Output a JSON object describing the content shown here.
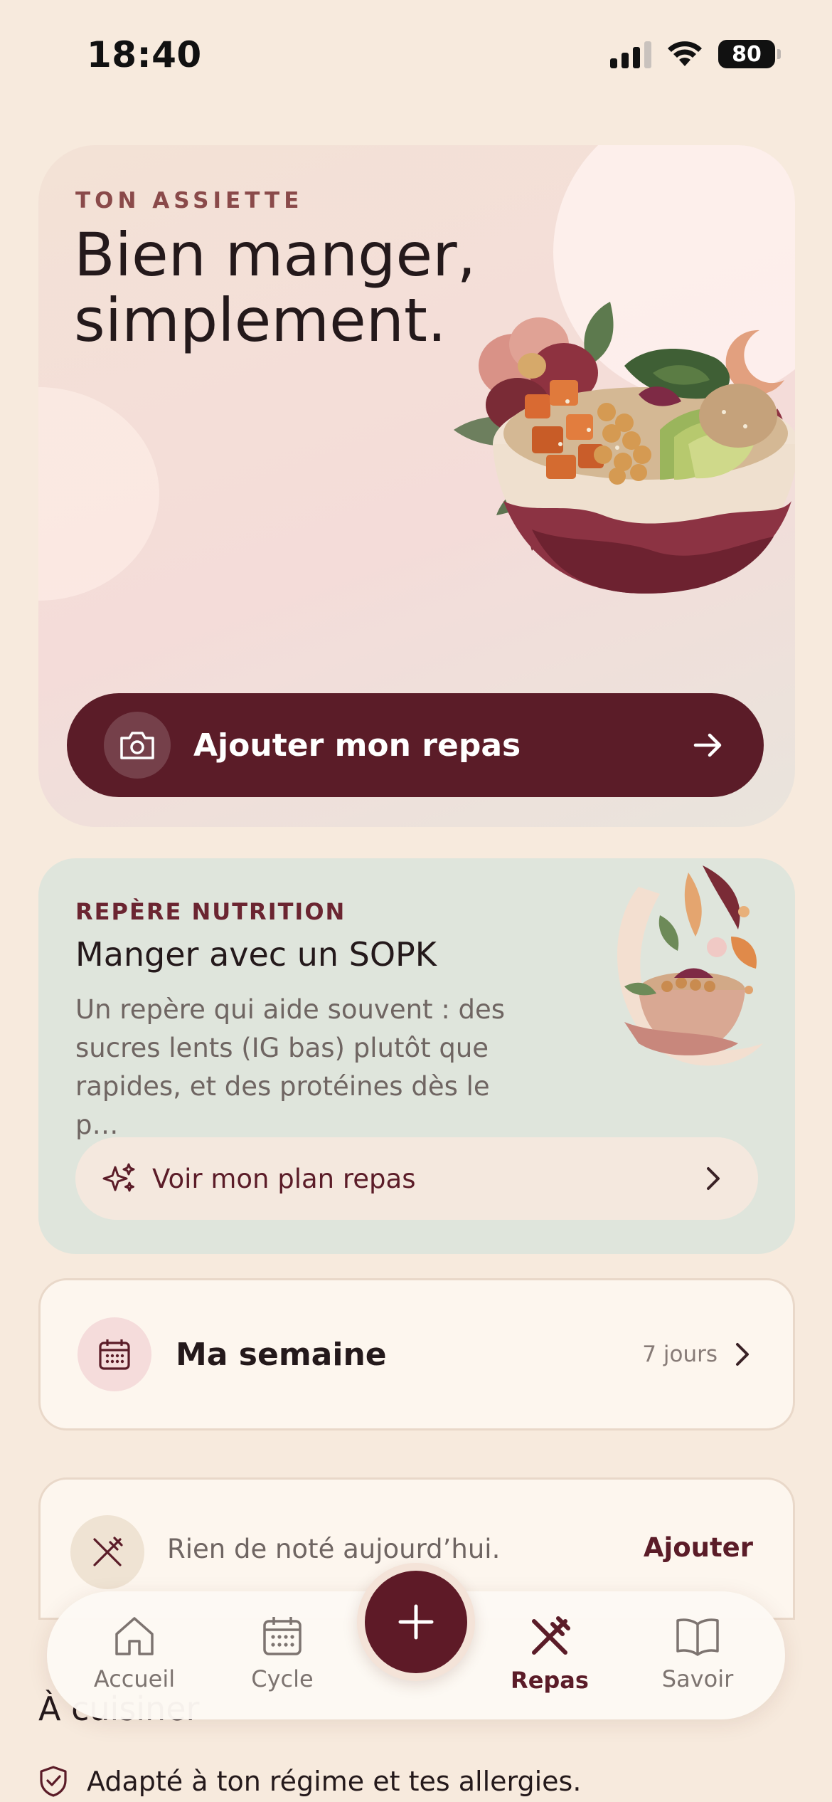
{
  "status_bar": {
    "time": "18:40",
    "battery": "80"
  },
  "hero": {
    "eyebrow": "TON ASSIETTE",
    "title_line1": "Bien manger,",
    "title_line2": "simplement.",
    "cta_label": "Ajouter mon repas"
  },
  "nutrition": {
    "eyebrow": "REPÈRE NUTRITION",
    "title": "Manger avec un SOPK",
    "description": "Un repère qui aide souvent : des sucres lents (IG bas) plutôt que rapides, et des protéines dès le p…",
    "plan_label": "Voir mon plan repas"
  },
  "week": {
    "title": "Ma semaine",
    "meta": "7 jours"
  },
  "today": {
    "empty_text": "Rien de noté aujourd’hui.",
    "add_label": "Ajouter"
  },
  "section": {
    "heading": "À cuisiner",
    "diet_note": "Adapté à ton régime et tes allergies."
  },
  "tabbar": {
    "items": [
      {
        "label": "Accueil",
        "icon": "home-icon"
      },
      {
        "label": "Cycle",
        "icon": "calendar-icon"
      },
      {
        "label": "Repas",
        "icon": "utensils-icon",
        "active": true
      },
      {
        "label": "Savoir",
        "icon": "book-icon"
      }
    ]
  },
  "colors": {
    "background": "#f7eadd",
    "accent": "#5b1c28",
    "hero_bg": "#f4dcd9",
    "nutrition_bg": "#dfe5dc"
  }
}
